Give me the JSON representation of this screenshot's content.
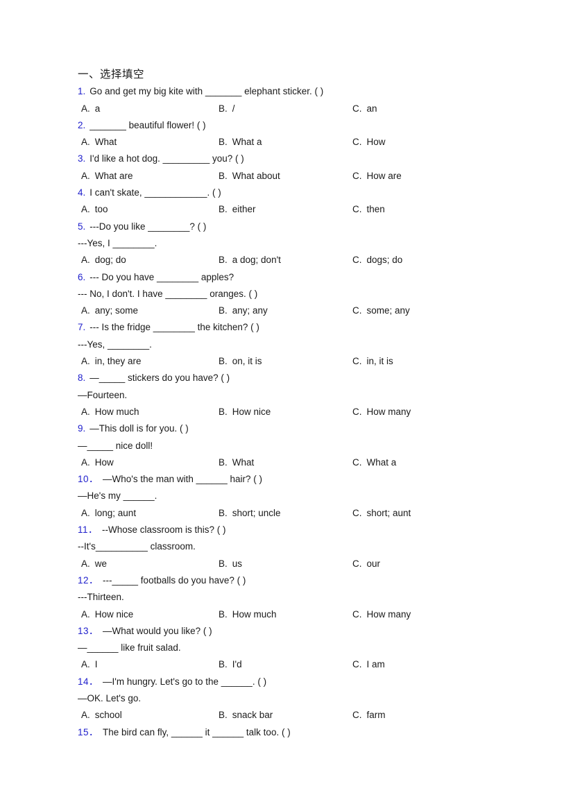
{
  "document": {
    "section_title": "一、选择填空",
    "lines": [
      {
        "kind": "question",
        "num": "1.",
        "text": "Go and get my big kite with _______ elephant sticker. (    )"
      },
      {
        "kind": "options",
        "a_label": "A.",
        "a": "a",
        "b_label": "B.",
        "b": "/",
        "c_label": "C.",
        "c": "an"
      },
      {
        "kind": "question",
        "num": "2.",
        "text": "_______ beautiful flower! (    )"
      },
      {
        "kind": "options",
        "a_label": "A.",
        "a": "What",
        "b_label": "B.",
        "b": "What a",
        "c_label": "C.",
        "c": "How"
      },
      {
        "kind": "question",
        "num": "3.",
        "text": "I'd like a hot dog. _________ you? (  )"
      },
      {
        "kind": "options",
        "a_label": "A.",
        "a": "What are",
        "b_label": "B.",
        "b": "What about",
        "c_label": "C.",
        "c": "How are"
      },
      {
        "kind": "question",
        "num": "4.",
        "text": "I can't skate, ____________. (  )"
      },
      {
        "kind": "options",
        "a_label": "A.",
        "a": "too",
        "b_label": "B.",
        "b": "either",
        "c_label": "C.",
        "c": "then"
      },
      {
        "kind": "question",
        "num": "5.",
        "text": "---Do you like ________? (   )"
      },
      {
        "kind": "cont",
        "text": "---Yes, I ________."
      },
      {
        "kind": "options",
        "a_label": "A.",
        "a": "dog; do",
        "b_label": "B.",
        "b": "a dog; don't",
        "c_label": "C.",
        "c": "dogs; do"
      },
      {
        "kind": "question",
        "num": "6.",
        "text": "--- Do you have ________ apples?"
      },
      {
        "kind": "cont",
        "text": "--- No, I don't. I have ________ oranges. (   )"
      },
      {
        "kind": "options",
        "a_label": "A.",
        "a": "any; some",
        "b_label": "B.",
        "b": "any; any",
        "c_label": "C.",
        "c": "some; any"
      },
      {
        "kind": "question",
        "num": "7.",
        "text": "--- Is the fridge ________ the kitchen? (   )"
      },
      {
        "kind": "cont",
        "text": "---Yes, ________."
      },
      {
        "kind": "options",
        "a_label": "A.",
        "a": "in, they are",
        "b_label": "B.",
        "b": "on, it is",
        "c_label": "C.",
        "c": "in, it is"
      },
      {
        "kind": "question",
        "num": "8.",
        "text": "—_____ stickers do you have? (   )"
      },
      {
        "kind": "cont",
        "text": "—Fourteen."
      },
      {
        "kind": "options",
        "a_label": "A.",
        "a": "How much",
        "b_label": "B.",
        "b": "How nice",
        "c_label": "C.",
        "c": "How many"
      },
      {
        "kind": "question",
        "num": "9.",
        "text": "—This doll is for you. (   )"
      },
      {
        "kind": "cont",
        "text": "—_____ nice doll!"
      },
      {
        "kind": "options",
        "a_label": "A.",
        "a": "How",
        "b_label": "B.",
        "b": "What",
        "c_label": "C.",
        "c": "What a"
      },
      {
        "kind": "question",
        "num": "10．",
        "text": "—Who's the man with ______ hair? (   )"
      },
      {
        "kind": "cont",
        "text": "—He's my ______."
      },
      {
        "kind": "options",
        "a_label": "A.",
        "a": "long; aunt",
        "b_label": "B.",
        "b": "short; uncle",
        "c_label": "C.",
        "c": "short; aunt"
      },
      {
        "kind": "question",
        "num": "11．",
        "text": "--Whose classroom is this? (   )"
      },
      {
        "kind": "cont",
        "text": "--It's__________ classroom."
      },
      {
        "kind": "options",
        "a_label": "A.",
        "a": "we",
        "b_label": "B.",
        "b": "us",
        "c_label": "C.",
        "c": "our"
      },
      {
        "kind": "question",
        "num": "12．",
        "text": "---_____ footballs do you have?  (  )"
      },
      {
        "kind": "cont",
        "text": "---Thirteen."
      },
      {
        "kind": "options",
        "a_label": "A.",
        "a": "How nice",
        "b_label": "B.",
        "b": "How much",
        "c_label": "C.",
        "c": "How many"
      },
      {
        "kind": "question",
        "num": "13．",
        "text": "—What would you like? (   )"
      },
      {
        "kind": "cont",
        "text": "—______ like fruit salad."
      },
      {
        "kind": "options",
        "a_label": "A.",
        "a": "I",
        "b_label": "B.",
        "b": "I'd",
        "c_label": "C.",
        "c": "I am"
      },
      {
        "kind": "question",
        "num": "14．",
        "text": "—I'm hungry. Let's go to the ______. (   )"
      },
      {
        "kind": "cont",
        "text": "—OK. Let's go."
      },
      {
        "kind": "options",
        "a_label": "A.",
        "a": "school",
        "b_label": "B.",
        "b": "snack bar",
        "c_label": "C.",
        "c": "farm"
      },
      {
        "kind": "question",
        "num": "15．",
        "text": "The bird can fly, ______ it ______ talk too. (   )"
      }
    ]
  },
  "colors": {
    "question_number": "#2020cc",
    "body_text": "#1a1a1a",
    "page_background": "#ffffff"
  }
}
